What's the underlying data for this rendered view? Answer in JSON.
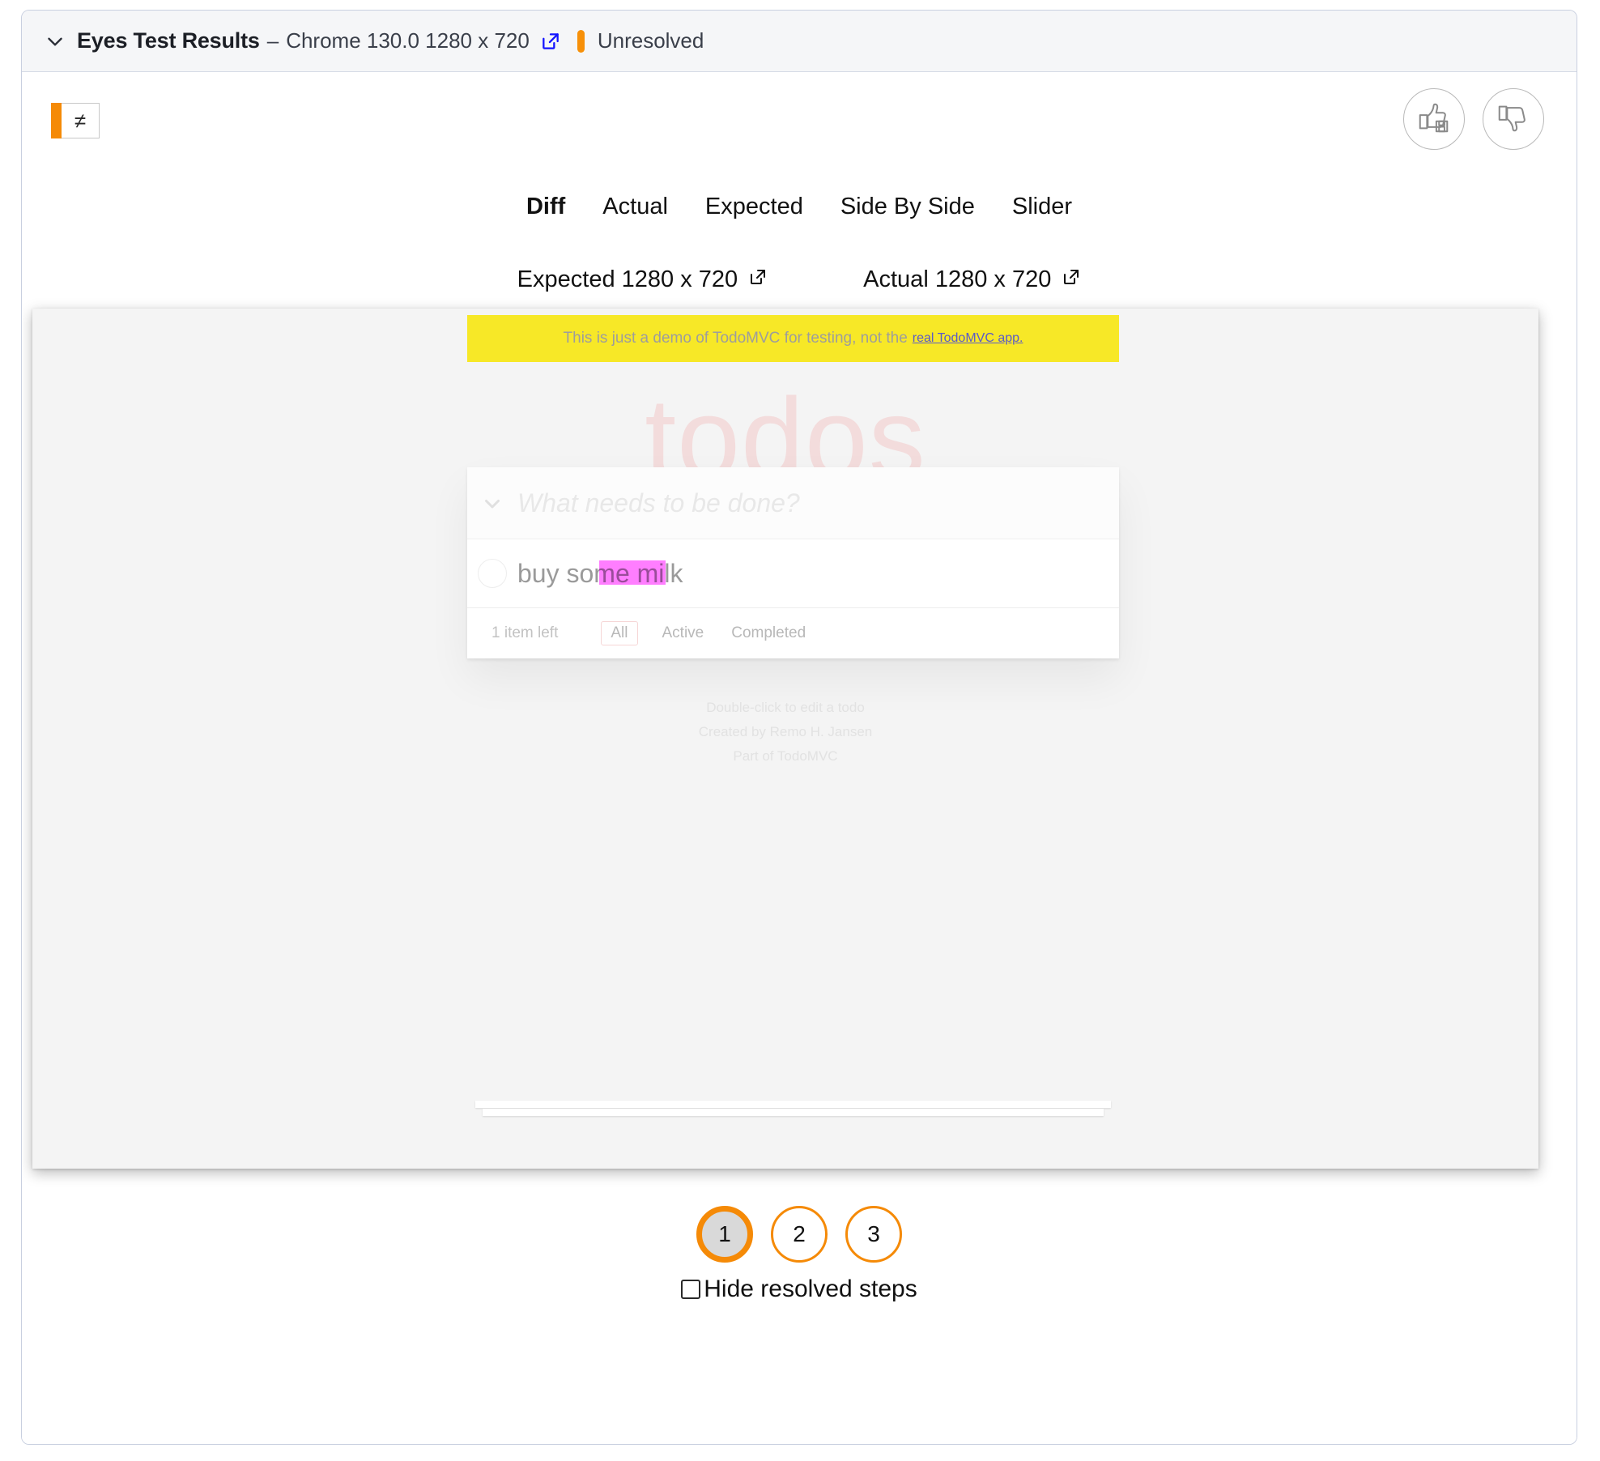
{
  "header": {
    "collapse_icon": "chevron-down-icon",
    "title": "Eyes Test Results",
    "separator": "–",
    "subtitle": "Chrome 130.0 1280 x 720",
    "external_link_icon": "external-link-icon",
    "status": "Unresolved",
    "status_color": "#F79009"
  },
  "toolbar": {
    "diff_mode_glyph": "≠",
    "diff_mode_name": "diff-mode-button",
    "thumbs_up_icon": "thumbs-up-save-icon",
    "thumbs_down_icon": "thumbs-down-icon"
  },
  "tabs": [
    {
      "label": "Diff",
      "active": true
    },
    {
      "label": "Actual",
      "active": false
    },
    {
      "label": "Expected",
      "active": false
    },
    {
      "label": "Side By Side",
      "active": false
    },
    {
      "label": "Slider",
      "active": false
    }
  ],
  "image_links": [
    {
      "label": "Expected 1280 x 720",
      "icon": "external-link-icon"
    },
    {
      "label": "Actual 1280 x 720",
      "icon": "external-link-icon"
    }
  ],
  "screenshot": {
    "banner": {
      "text": "This is just a demo of TodoMVC for testing, not the",
      "link_text": "real TodoMVC app.",
      "background": "#F7E827"
    },
    "app_title": "todos",
    "new_todo_placeholder": "What needs to be done?",
    "toggle_all_icon": "chevron-down-icon",
    "todos": [
      {
        "label": "buy some milk",
        "completed": false,
        "has_diff": true
      }
    ],
    "items_left": "1 item left",
    "filters": [
      {
        "label": "All",
        "selected": true
      },
      {
        "label": "Active",
        "selected": false
      },
      {
        "label": "Completed",
        "selected": false
      }
    ],
    "info": [
      "Double-click to edit a todo",
      "Created by Remo H. Jansen",
      "Part of TodoMVC"
    ],
    "diff_highlight_color": "#FF4CFF"
  },
  "steps": {
    "items": [
      {
        "label": "1",
        "selected": true
      },
      {
        "label": "2",
        "selected": false
      },
      {
        "label": "3",
        "selected": false
      }
    ],
    "hide_resolved_label": "Hide resolved steps",
    "hide_resolved_checked": false,
    "accent_color": "#F58A07"
  }
}
